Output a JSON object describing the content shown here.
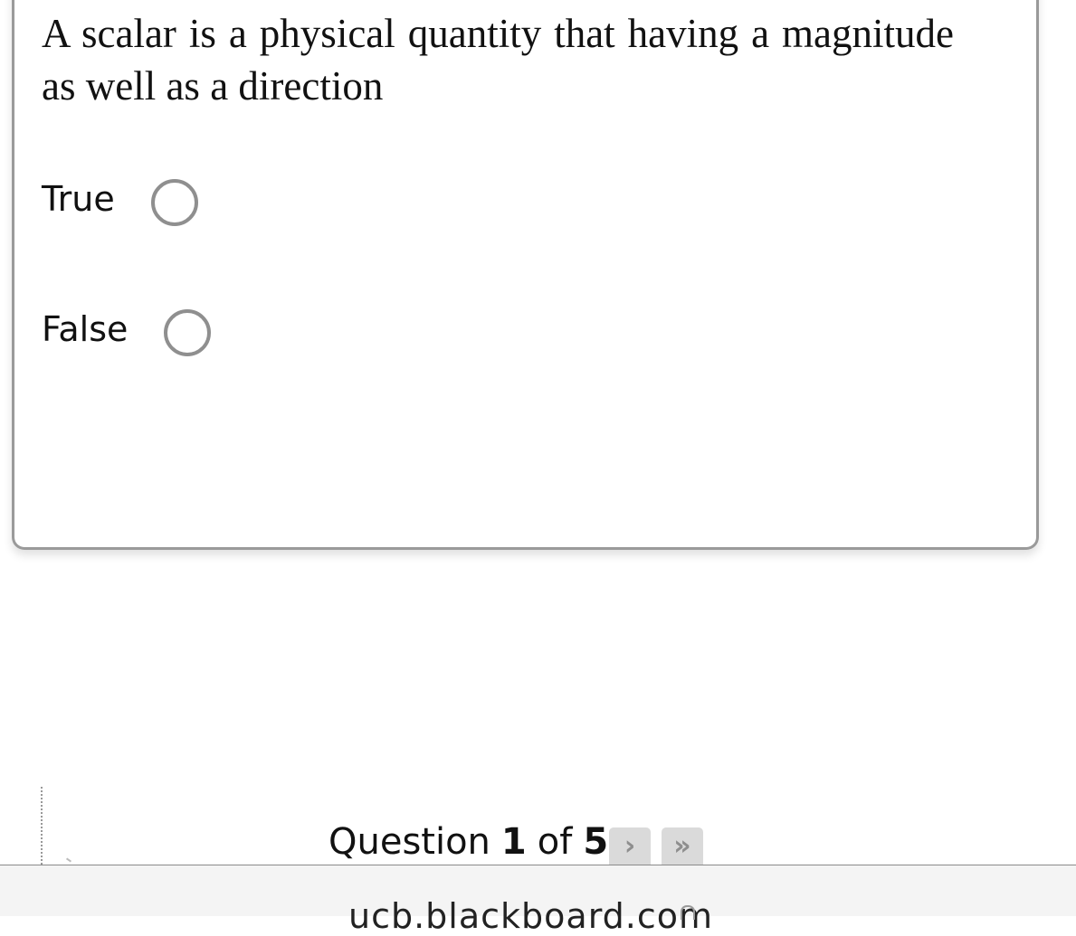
{
  "question": {
    "text": "A scalar is a physical quantity that having a magnitude as well as a direction",
    "options": [
      {
        "label": "True",
        "selected": false
      },
      {
        "label": "False",
        "selected": false
      }
    ]
  },
  "pager": {
    "prefix": "Question",
    "current": "1",
    "of_label": "of",
    "total": "5",
    "next_icon": "›",
    "last_icon": "»"
  },
  "browser": {
    "url": "ucb.blackboard.com",
    "lock_icon": "lock-icon"
  }
}
